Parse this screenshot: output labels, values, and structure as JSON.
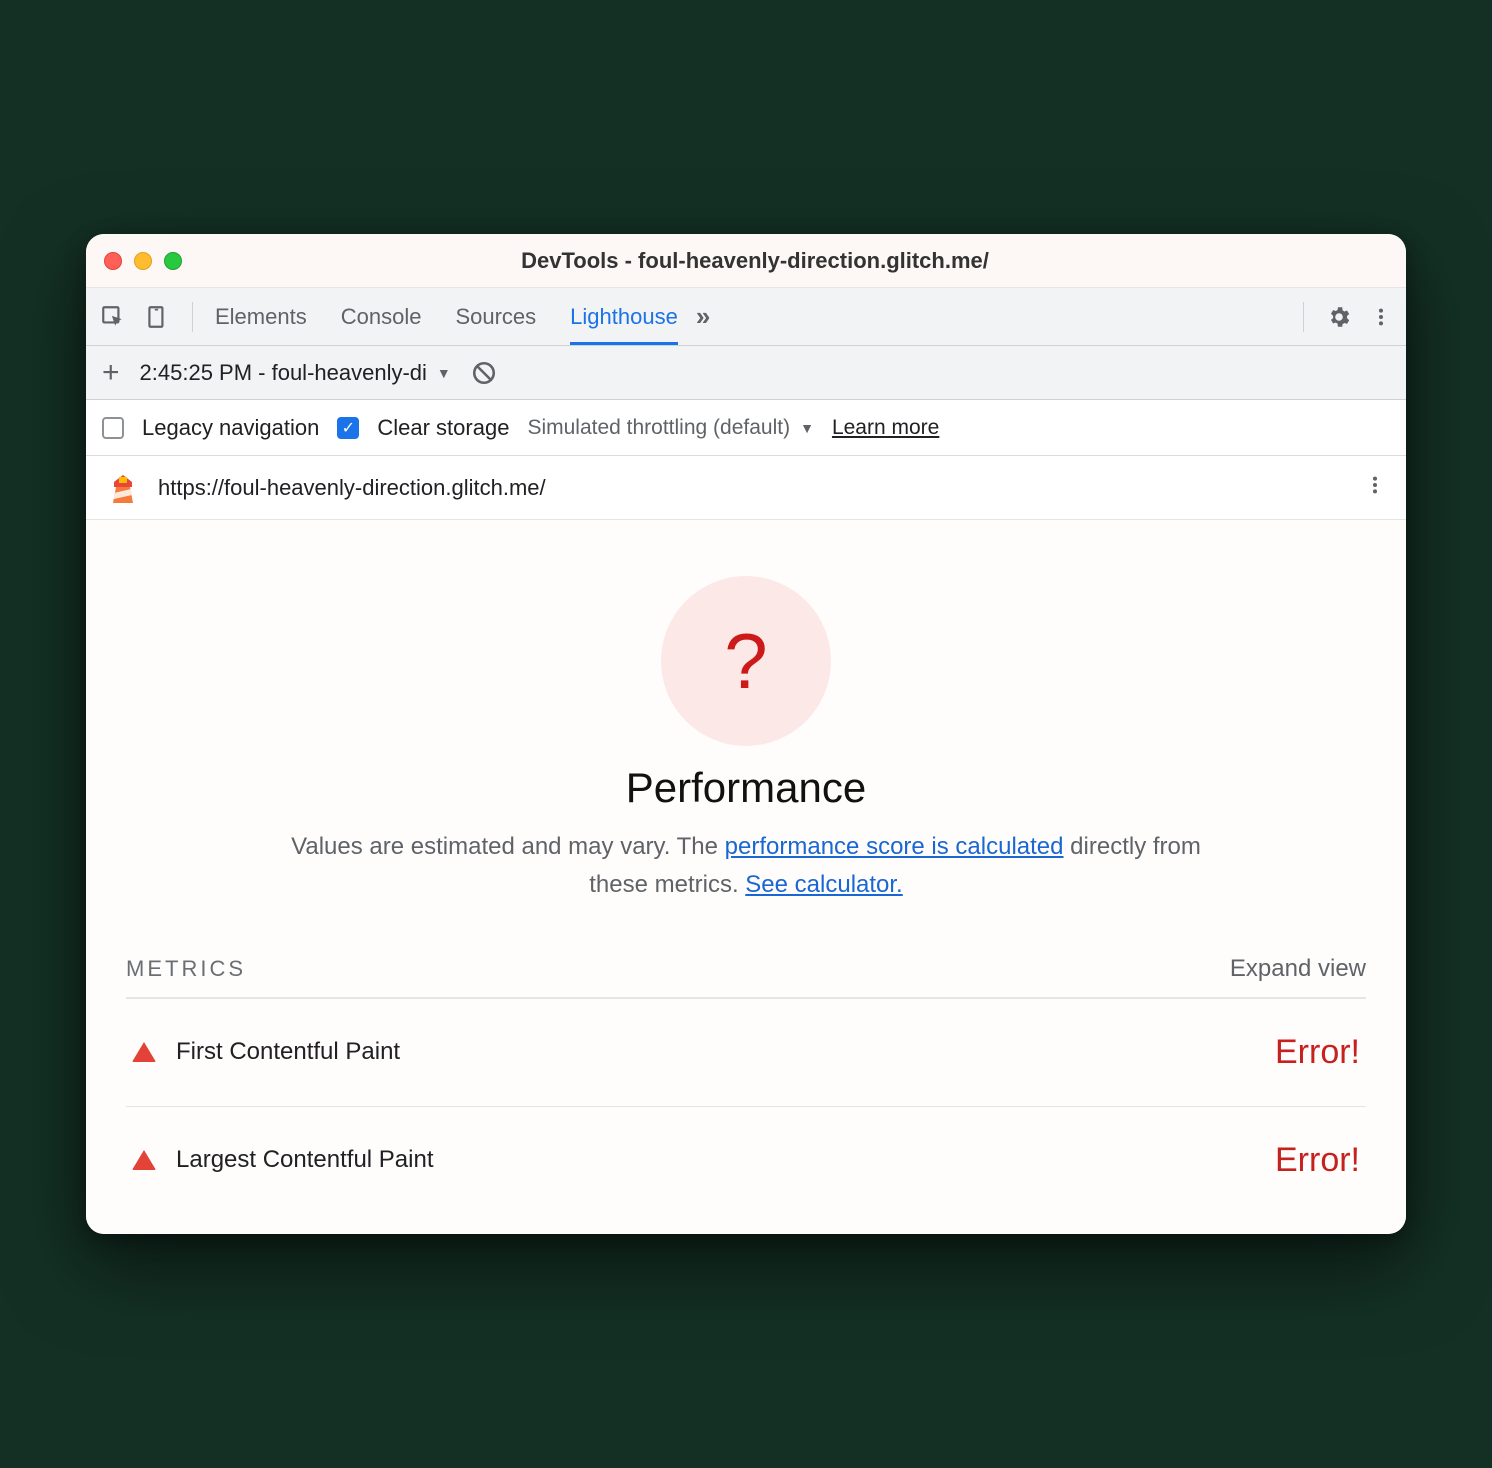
{
  "window": {
    "title": "DevTools - foul-heavenly-direction.glitch.me/"
  },
  "tabs": {
    "items": [
      "Elements",
      "Console",
      "Sources",
      "Lighthouse"
    ],
    "active": "Lighthouse"
  },
  "subbar1": {
    "report_label": "2:45:25 PM - foul-heavenly-di"
  },
  "options": {
    "legacy_nav": "Legacy navigation",
    "clear_storage": "Clear storage",
    "throttling": "Simulated throttling (default)",
    "learn_more": "Learn more"
  },
  "url": "https://foul-heavenly-direction.glitch.me/",
  "score_badge": "?",
  "perf_title": "Performance",
  "desc": {
    "part1": "Values are estimated and may vary. The ",
    "link1": "performance score is calculated",
    "part2": " directly from these metrics. ",
    "link2": "See calculator."
  },
  "metrics": {
    "header": "METRICS",
    "expand": "Expand view",
    "rows": [
      {
        "name": "First Contentful Paint",
        "value": "Error!"
      },
      {
        "name": "Largest Contentful Paint",
        "value": "Error!"
      }
    ]
  }
}
